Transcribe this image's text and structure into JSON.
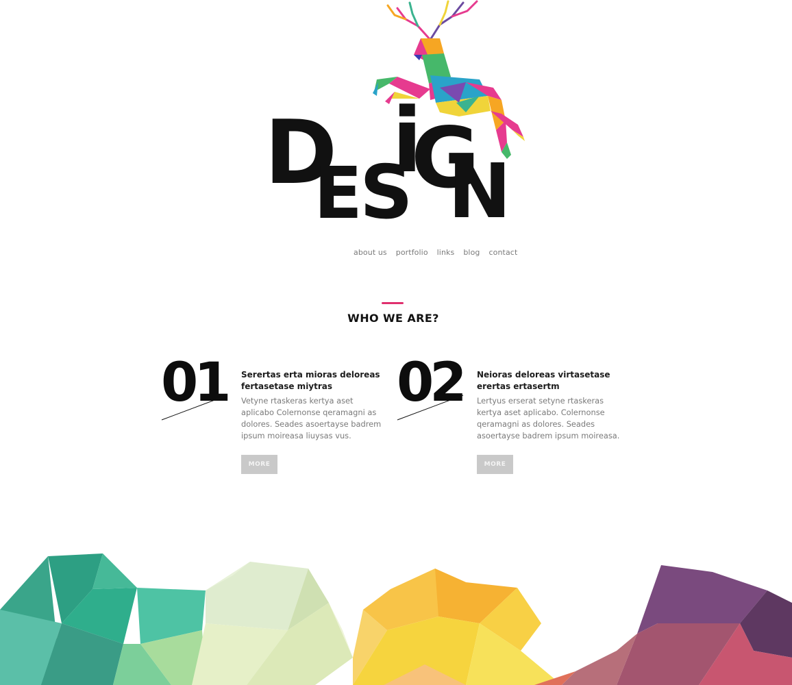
{
  "logo": {
    "letters": [
      "D",
      "E",
      "S",
      "i",
      "G",
      "N"
    ],
    "colors": {
      "text": "#111111"
    }
  },
  "nav": {
    "items": [
      {
        "label": "about us"
      },
      {
        "label": "portfolio"
      },
      {
        "label": "links"
      },
      {
        "label": "blog"
      },
      {
        "label": "contact"
      }
    ]
  },
  "section": {
    "title": "WHO WE ARE?",
    "accent_color": "#e0306e"
  },
  "features": [
    {
      "number": "01",
      "title": "Serertas erta mioras deloreas fertasetase miytras",
      "text": "Vetyne rtaskeras kertya aset aplicabo Colernonse qeramagni as dolores. Seades asoertayse badrem ipsum moireasa liuysas vus.",
      "button_label": "MORE"
    },
    {
      "number": "02",
      "title": "Neioras deloreas virtasetase erertas ertasertm",
      "text": "Lertyus erserat setyne rtaskeras kertya aset aplicabo. Colernonse qeramagni as dolores. Seades asoertayse badrem ipsum moireasa.",
      "button_label": "MORE"
    }
  ],
  "footer": {
    "colors": [
      "#2fae8c",
      "#dce9b8",
      "#f6c33b",
      "#7a4a7e"
    ]
  }
}
